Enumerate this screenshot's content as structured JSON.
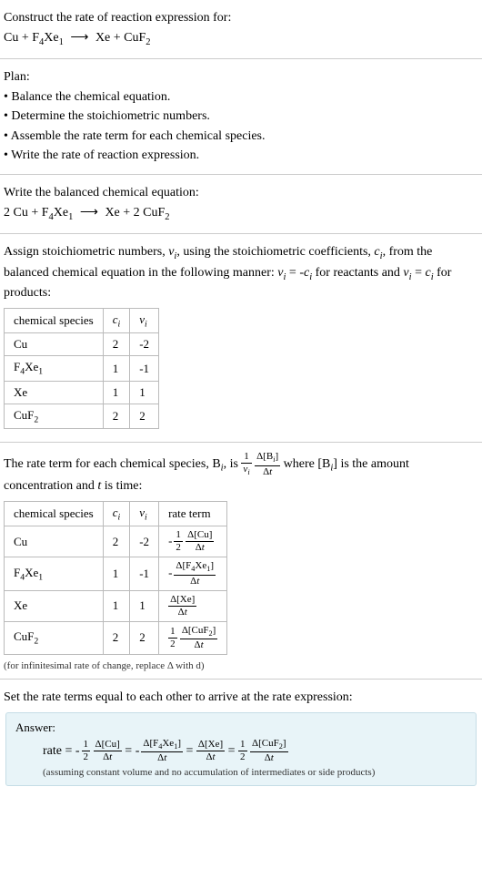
{
  "prompt": {
    "title": "Construct the rate of reaction expression for:",
    "equation_lhs1": "Cu + F",
    "equation_lhs2": "Xe",
    "equation_rhs1": "Xe + CuF"
  },
  "plan": {
    "title": "Plan:",
    "items": [
      "• Balance the chemical equation.",
      "• Determine the stoichiometric numbers.",
      "• Assemble the rate term for each chemical species.",
      "• Write the rate of reaction expression."
    ]
  },
  "balanced": {
    "title": "Write the balanced chemical equation:",
    "eq_pre": "2 Cu + F",
    "eq_mid": "Xe",
    "eq_post": "Xe + 2 CuF"
  },
  "assign": {
    "text1": "Assign stoichiometric numbers, ",
    "text2": ", using the stoichiometric coefficients, ",
    "text3": ", from the balanced chemical equation in the following manner: ",
    "text4": " for reactants and ",
    "text5": " for products:"
  },
  "table1": {
    "headers": [
      "chemical species",
      "cᵢ",
      "νᵢ"
    ],
    "rows": [
      {
        "species": "Cu",
        "c": "2",
        "v": "-2"
      },
      {
        "species": "F4Xe1",
        "c": "1",
        "v": "-1"
      },
      {
        "species": "Xe",
        "c": "1",
        "v": "1"
      },
      {
        "species": "CuF2",
        "c": "2",
        "v": "2"
      }
    ]
  },
  "rateterm": {
    "text1": "The rate term for each chemical species, B",
    "text2": ", is ",
    "text3": " where [B",
    "text4": "] is the amount concentration and ",
    "text5": " is time:"
  },
  "table2": {
    "headers": [
      "chemical species",
      "cᵢ",
      "νᵢ",
      "rate term"
    ]
  },
  "footnote": "(for infinitesimal rate of change, replace Δ with d)",
  "final": {
    "title": "Set the rate terms equal to each other to arrive at the rate expression:",
    "answer_label": "Answer:",
    "rate_label": "rate = ",
    "note": "(assuming constant volume and no accumulation of intermediates or side products)"
  }
}
